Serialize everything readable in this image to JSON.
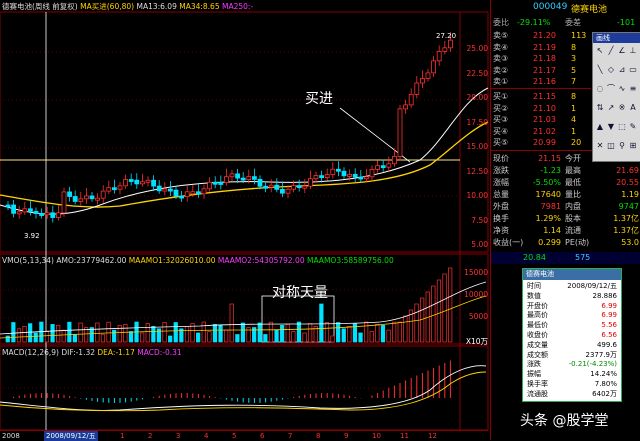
{
  "header": {
    "title": "德赛电池(周线 前复权)",
    "ma_label": "MA买进(60,80)",
    "ma13": "MA13:6.09",
    "ma34": "MA34:8.65",
    "ma250": "MA250:-"
  },
  "annotations": {
    "buy": "买进",
    "symmetric_volume": "对称天量",
    "high_price": "27.20",
    "low_price": "3.92"
  },
  "price_axis": [
    "25.00",
    "22.50",
    "20.00",
    "17.50",
    "15.00",
    "12.50",
    "10.00",
    "7.50",
    "5.00"
  ],
  "volume_header": {
    "vol": "VMO(5,13,34)",
    "amo": "AMO:23779462.00",
    "maamo1": "MAAMO1:32026010.00",
    "maamo2": "MAAMO2:54305792.00",
    "maamo3": "MAAMO3:58589756.00"
  },
  "volume_axis": [
    "15000",
    "10000",
    "5000",
    "X10万"
  ],
  "macd_header": {
    "macd": "MACD(12,26,9)",
    "dif": "DIF:-1.32",
    "dea": "DEA:-1.17",
    "val": "MACD:-0.31"
  },
  "date_bar": {
    "left": "2008",
    "cursor": "2008/09/12/五",
    "ticks": [
      "1",
      "2",
      "3",
      "4",
      "5",
      "6",
      "7",
      "8",
      "9",
      "10",
      "11",
      "12"
    ]
  },
  "quote": {
    "code": "000049",
    "name": "德赛电池",
    "weibi_label": "委比",
    "weibi_value": "-29.11%",
    "weicha_label": "委差",
    "weicha_value": "-101",
    "asks": [
      {
        "label": "卖⑤",
        "price": "21.20",
        "vol": "113"
      },
      {
        "label": "卖④",
        "price": "21.19",
        "vol": "8"
      },
      {
        "label": "卖③",
        "price": "21.18",
        "vol": "3"
      },
      {
        "label": "卖②",
        "price": "21.17",
        "vol": "5"
      },
      {
        "label": "卖①",
        "price": "21.16",
        "vol": "7"
      }
    ],
    "bids": [
      {
        "label": "买①",
        "price": "21.15",
        "vol": "8"
      },
      {
        "label": "买②",
        "price": "21.10",
        "vol": "1"
      },
      {
        "label": "买③",
        "price": "21.03",
        "vol": "4"
      },
      {
        "label": "买④",
        "price": "21.02",
        "vol": "1"
      },
      {
        "label": "买⑤",
        "price": "20.99",
        "vol": "20"
      }
    ],
    "stats": [
      {
        "k1": "现价",
        "v1": "21.15",
        "k2": "今开",
        "v2": "19.97"
      },
      {
        "k1": "涨跌",
        "v1": "-1.23",
        "k2": "最高",
        "v2": "21.69"
      },
      {
        "k1": "涨幅",
        "v1": "-5.50%",
        "k2": "最低",
        "v2": "20.55"
      },
      {
        "k1": "总量",
        "v1": "17640",
        "k2": "量比",
        "v2": "1.19"
      },
      {
        "k1": "外盘",
        "v1": "7981",
        "k2": "内盘",
        "v2": "9747"
      },
      {
        "k1": "换手",
        "v1": "1.29%",
        "k2": "股本",
        "v2": "1.37亿"
      },
      {
        "k1": "净资",
        "v1": "1.14",
        "k2": "流通",
        "v2": "1.37亿"
      },
      {
        "k1": "收益(一)",
        "v1": "0.299",
        "k2": "PE(动)",
        "v2": "53.0"
      }
    ],
    "tick_row": {
      "price": "20.84",
      "vol": "575"
    }
  },
  "toolbox": {
    "title": "画线"
  },
  "popup": {
    "title": "德赛电池",
    "rows": [
      {
        "k": "时间",
        "v": "2008/09/12/五"
      },
      {
        "k": "数值",
        "v": "28.886"
      },
      {
        "k": "开盘价",
        "v": "6.99"
      },
      {
        "k": "最高价",
        "v": "6.99"
      },
      {
        "k": "最低价",
        "v": "5.56"
      },
      {
        "k": "收盘价",
        "v": "6.56"
      },
      {
        "k": "成交量",
        "v": "499.6"
      },
      {
        "k": "成交额",
        "v": "2377.9万"
      },
      {
        "k": "涨跌",
        "v": "-0.21(-4.23%)"
      },
      {
        "k": "振幅",
        "v": "14.24%"
      },
      {
        "k": "换手率",
        "v": "7.80%"
      },
      {
        "k": "流通股",
        "v": "6402万"
      }
    ]
  },
  "watermark": {
    "text": "头条 @股学堂"
  },
  "colors": {
    "up": "#ff3030",
    "down": "#00e0ff",
    "ma_yellow": "#ffd400",
    "ma_white": "#ffffff",
    "grid": "#600000"
  }
}
